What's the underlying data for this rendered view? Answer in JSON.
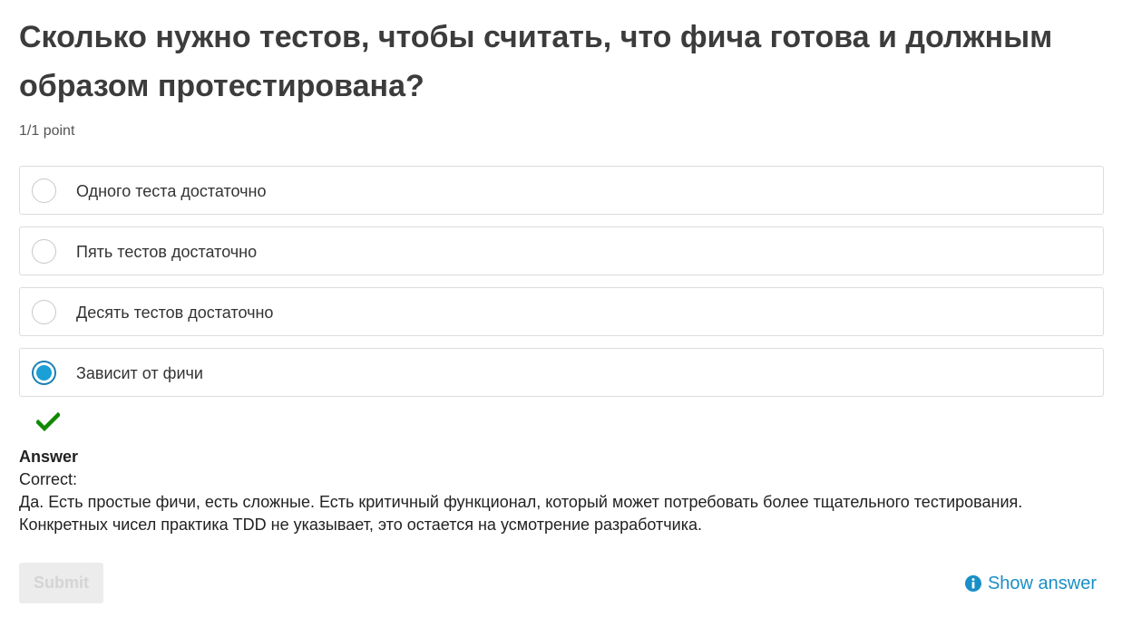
{
  "question": {
    "title": "Сколько нужно тестов, чтобы считать, что фича готова и должным образом протестирована?",
    "points": "1/1 point"
  },
  "options": [
    {
      "label": "Одного теста достаточно",
      "selected": false
    },
    {
      "label": "Пять тестов достаточно",
      "selected": false
    },
    {
      "label": "Десять тестов достаточно",
      "selected": false
    },
    {
      "label": "Зависит от фичи",
      "selected": true
    }
  ],
  "result": {
    "icon": "checkmark-icon",
    "color": "#108a00"
  },
  "answer": {
    "title": "Answer",
    "status": "Correct:",
    "explanation": "Да. Есть простые фичи, есть сложные. Есть критичный функционал, который может потребовать более тщательного тестирования. Конкретных чисел практика TDD не указывает, это остается на усмотрение разработчика."
  },
  "actions": {
    "submit_label": "Submit",
    "submit_disabled": true,
    "show_answer_label": "Show answer",
    "show_answer_icon": "info-icon"
  },
  "colors": {
    "accent": "#1a8fc6",
    "selected_radio": "#1a9fd6",
    "success": "#108a00"
  }
}
